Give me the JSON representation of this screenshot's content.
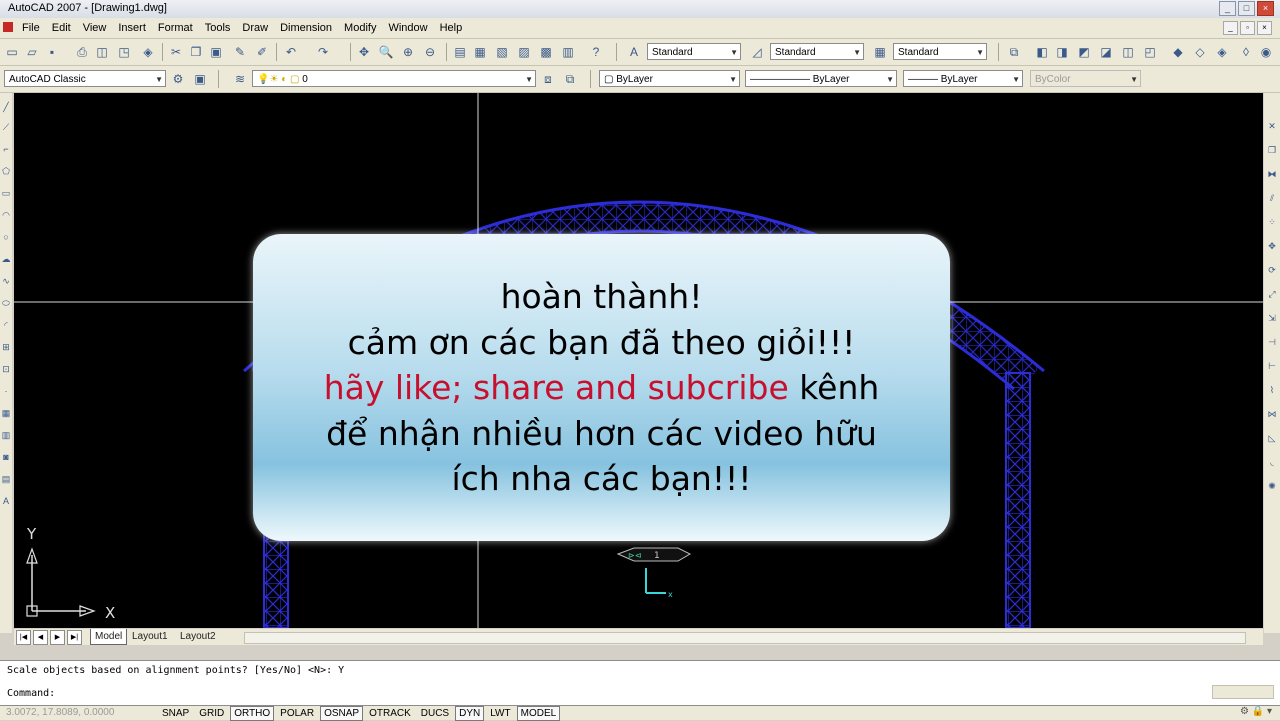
{
  "window": {
    "title": "AutoCAD 2007 - [Drawing1.dwg]",
    "min": "_",
    "max": "□",
    "close": "×"
  },
  "menu": [
    "File",
    "Edit",
    "View",
    "Insert",
    "Format",
    "Tools",
    "Draw",
    "Dimension",
    "Modify",
    "Window",
    "Help"
  ],
  "toolbar": {
    "text_style": "Standard",
    "dim_style": "Standard",
    "table_style": "Standard",
    "workspace": "AutoCAD Classic",
    "layer": "0",
    "color": "ByLayer",
    "linetype": "ByLayer",
    "lineweight": "ByLayer",
    "plotstyle": "ByColor"
  },
  "viewport": {
    "ucs_x": "X",
    "ucs_y": "Y",
    "grip_label": "1",
    "cursor_x": "x"
  },
  "tabs": [
    "Model",
    "Layout1",
    "Layout2"
  ],
  "popup": {
    "line1": "hoàn thành!",
    "line2": "cảm ơn các bạn đã theo giỏi!!!",
    "line3_red": "hãy like; share and subcribe",
    "line3_rest": " kênh",
    "line4": "để nhận nhiều hơn các video hữu",
    "line5": "ích nha các bạn!!!"
  },
  "command": {
    "history": "Scale objects based on alignment points? [Yes/No] <N>: Y",
    "prompt": "Command:"
  },
  "status": {
    "coords": "3.0072, 17.8089, 0.0000",
    "buttons": [
      {
        "label": "SNAP",
        "on": false
      },
      {
        "label": "GRID",
        "on": false
      },
      {
        "label": "ORTHO",
        "on": true
      },
      {
        "label": "POLAR",
        "on": false
      },
      {
        "label": "OSNAP",
        "on": true
      },
      {
        "label": "OTRACK",
        "on": false
      },
      {
        "label": "DUCS",
        "on": false
      },
      {
        "label": "DYN",
        "on": true
      },
      {
        "label": "LWT",
        "on": false
      },
      {
        "label": "MODEL",
        "on": true
      }
    ]
  },
  "colors": {
    "canvas": "#000000",
    "truss": "#2c2cd8",
    "crosshair": "#d8d8d8",
    "popup_red": "#c8102e",
    "ucs": "#e0e0e0"
  }
}
